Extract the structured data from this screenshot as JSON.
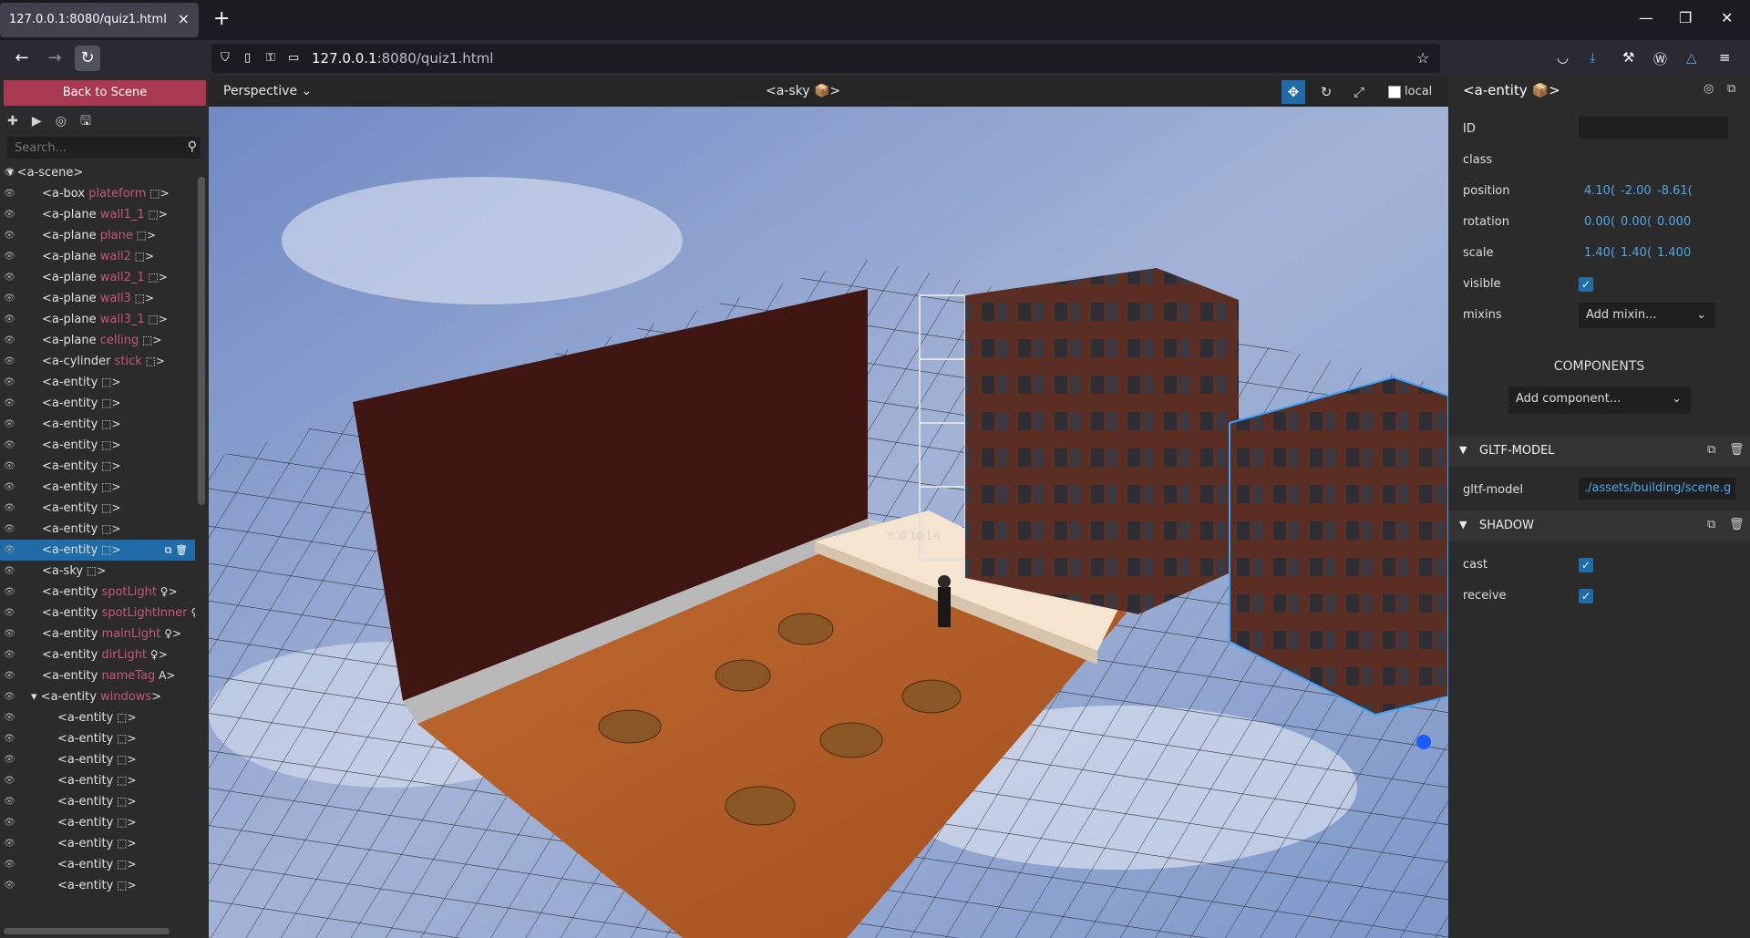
{
  "browser": {
    "tab_title": "127.0.0.1:8080/quiz1.html",
    "tab_close": "×",
    "new_tab": "+",
    "url_host": "127.0.0.1",
    "url_path": ":8080/quiz1.html"
  },
  "left_panel": {
    "back_button": "Back to Scene",
    "search_placeholder": "Search...",
    "tree": [
      {
        "tag": "<a-scene>",
        "name": "",
        "icon": "",
        "level": 0,
        "expanded": true
      },
      {
        "tag": "<a-box",
        "name": "plateform",
        "icon": "cube",
        "level": 1
      },
      {
        "tag": "<a-plane",
        "name": "wall1_1",
        "icon": "cube",
        "level": 1
      },
      {
        "tag": "<a-plane",
        "name": "plane",
        "icon": "cube",
        "level": 1
      },
      {
        "tag": "<a-plane",
        "name": "wall2",
        "icon": "cube",
        "level": 1
      },
      {
        "tag": "<a-plane",
        "name": "wall2_1",
        "icon": "cube",
        "level": 1
      },
      {
        "tag": "<a-plane",
        "name": "wall3",
        "icon": "cube",
        "level": 1
      },
      {
        "tag": "<a-plane",
        "name": "wall3_1",
        "icon": "cube",
        "level": 1
      },
      {
        "tag": "<a-plane",
        "name": "celling",
        "icon": "cube",
        "level": 1
      },
      {
        "tag": "<a-cylinder",
        "name": "stick",
        "icon": "cube",
        "level": 1
      },
      {
        "tag": "<a-entity",
        "name": "",
        "icon": "cube",
        "level": 1
      },
      {
        "tag": "<a-entity",
        "name": "",
        "icon": "cube",
        "level": 1
      },
      {
        "tag": "<a-entity",
        "name": "",
        "icon": "cube",
        "level": 1
      },
      {
        "tag": "<a-entity",
        "name": "",
        "icon": "cube",
        "level": 1
      },
      {
        "tag": "<a-entity",
        "name": "",
        "icon": "cube",
        "level": 1
      },
      {
        "tag": "<a-entity",
        "name": "",
        "icon": "cube",
        "level": 1
      },
      {
        "tag": "<a-entity",
        "name": "",
        "icon": "cube",
        "level": 1
      },
      {
        "tag": "<a-entity",
        "name": "",
        "icon": "cube",
        "level": 1
      },
      {
        "tag": "<a-entity",
        "name": "",
        "icon": "cube",
        "level": 1,
        "selected": true
      },
      {
        "tag": "<a-sky",
        "name": "",
        "icon": "cube",
        "level": 1
      },
      {
        "tag": "<a-entity",
        "name": "spotLight",
        "icon": "bulb",
        "level": 1
      },
      {
        "tag": "<a-entity",
        "name": "spotLightInner",
        "icon": "bulb",
        "level": 1
      },
      {
        "tag": "<a-entity",
        "name": "mainLight",
        "icon": "bulb",
        "level": 1
      },
      {
        "tag": "<a-entity",
        "name": "dirLight",
        "icon": "bulb",
        "level": 1
      },
      {
        "tag": "<a-entity",
        "name": "nameTag",
        "icon": "text",
        "level": 1
      },
      {
        "tag": "<a-entity",
        "name": "windows",
        "icon": "",
        "level": 1,
        "expanded": true
      },
      {
        "tag": "<a-entity",
        "name": "",
        "icon": "cube",
        "level": 2
      },
      {
        "tag": "<a-entity",
        "name": "",
        "icon": "cube",
        "level": 2
      },
      {
        "tag": "<a-entity",
        "name": "",
        "icon": "cube",
        "level": 2
      },
      {
        "tag": "<a-entity",
        "name": "",
        "icon": "cube",
        "level": 2
      },
      {
        "tag": "<a-entity",
        "name": "",
        "icon": "cube",
        "level": 2
      },
      {
        "tag": "<a-entity",
        "name": "",
        "icon": "cube",
        "level": 2
      },
      {
        "tag": "<a-entity",
        "name": "",
        "icon": "cube",
        "level": 2
      },
      {
        "tag": "<a-entity",
        "name": "",
        "icon": "cube",
        "level": 2
      },
      {
        "tag": "<a-entity",
        "name": "",
        "icon": "cube",
        "level": 2
      }
    ]
  },
  "viewport": {
    "camera": "Perspective",
    "title": "<a-sky 📦>",
    "local_label": "local",
    "floating_text": "Y: 0.10 Ln"
  },
  "right_panel": {
    "title": "<a-entity 📦>",
    "id_label": "ID",
    "class_label": "class",
    "position_label": "position",
    "position": [
      "4.10(",
      "-2.00",
      "-8.61("
    ],
    "rotation_label": "rotation",
    "rotation": [
      "0.00(",
      "0.00(",
      "0.000"
    ],
    "scale_label": "scale",
    "scale": [
      "1.40(",
      "1.40(",
      "1.400"
    ],
    "visible_label": "visible",
    "mixins_label": "mixins",
    "mixins_value": "Add mixin...",
    "components_header": "COMPONENTS",
    "add_component": "Add component...",
    "gltf_section": "GLTF-MODEL",
    "gltf_label": "gltf-model",
    "gltf_value": "./assets/building/scene.g",
    "shadow_section": "SHADOW",
    "cast_label": "cast",
    "receive_label": "receive"
  }
}
